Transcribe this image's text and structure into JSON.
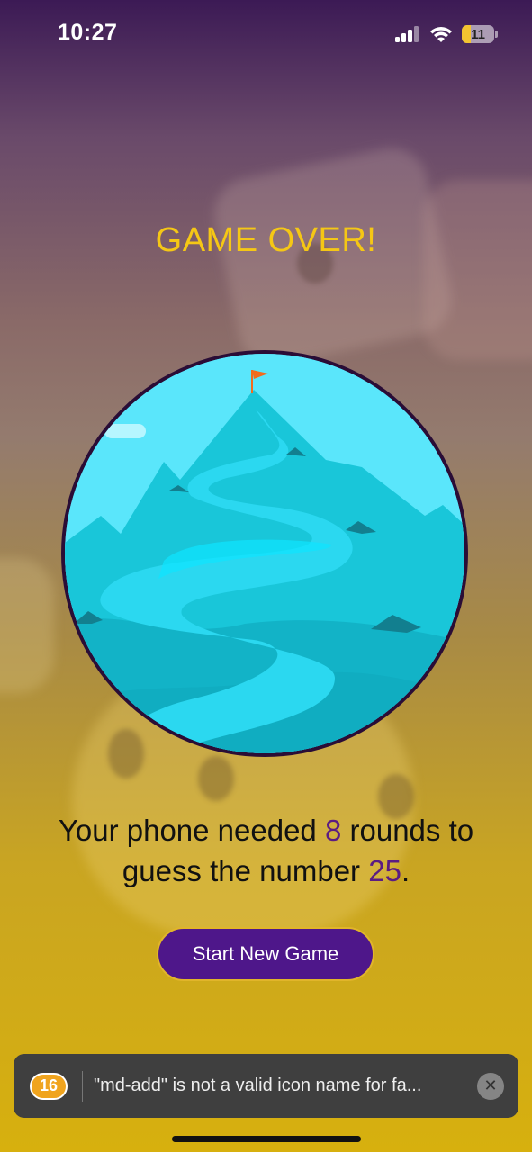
{
  "status_bar": {
    "time": "10:27",
    "battery_level": "11",
    "icons": [
      "signal-icon",
      "wifi-icon",
      "battery-icon"
    ]
  },
  "game_over": {
    "title": "GAME OVER!",
    "summary": {
      "prefix": "Your phone needed ",
      "rounds": "8",
      "middle": " rounds to guess the number ",
      "number": "25",
      "suffix": "."
    },
    "start_button": "Start New Game"
  },
  "toast": {
    "count": "16",
    "message": "\"md-add\" is not a valid icon name for fa...",
    "icon": "close-icon"
  },
  "colors": {
    "title": "#f5c715",
    "highlight": "#5b1c82",
    "button": "#4e178a",
    "button_border": "#e1b52a",
    "toast_bg": "#3f3f3f",
    "toast_badge": "#f0a41e"
  }
}
